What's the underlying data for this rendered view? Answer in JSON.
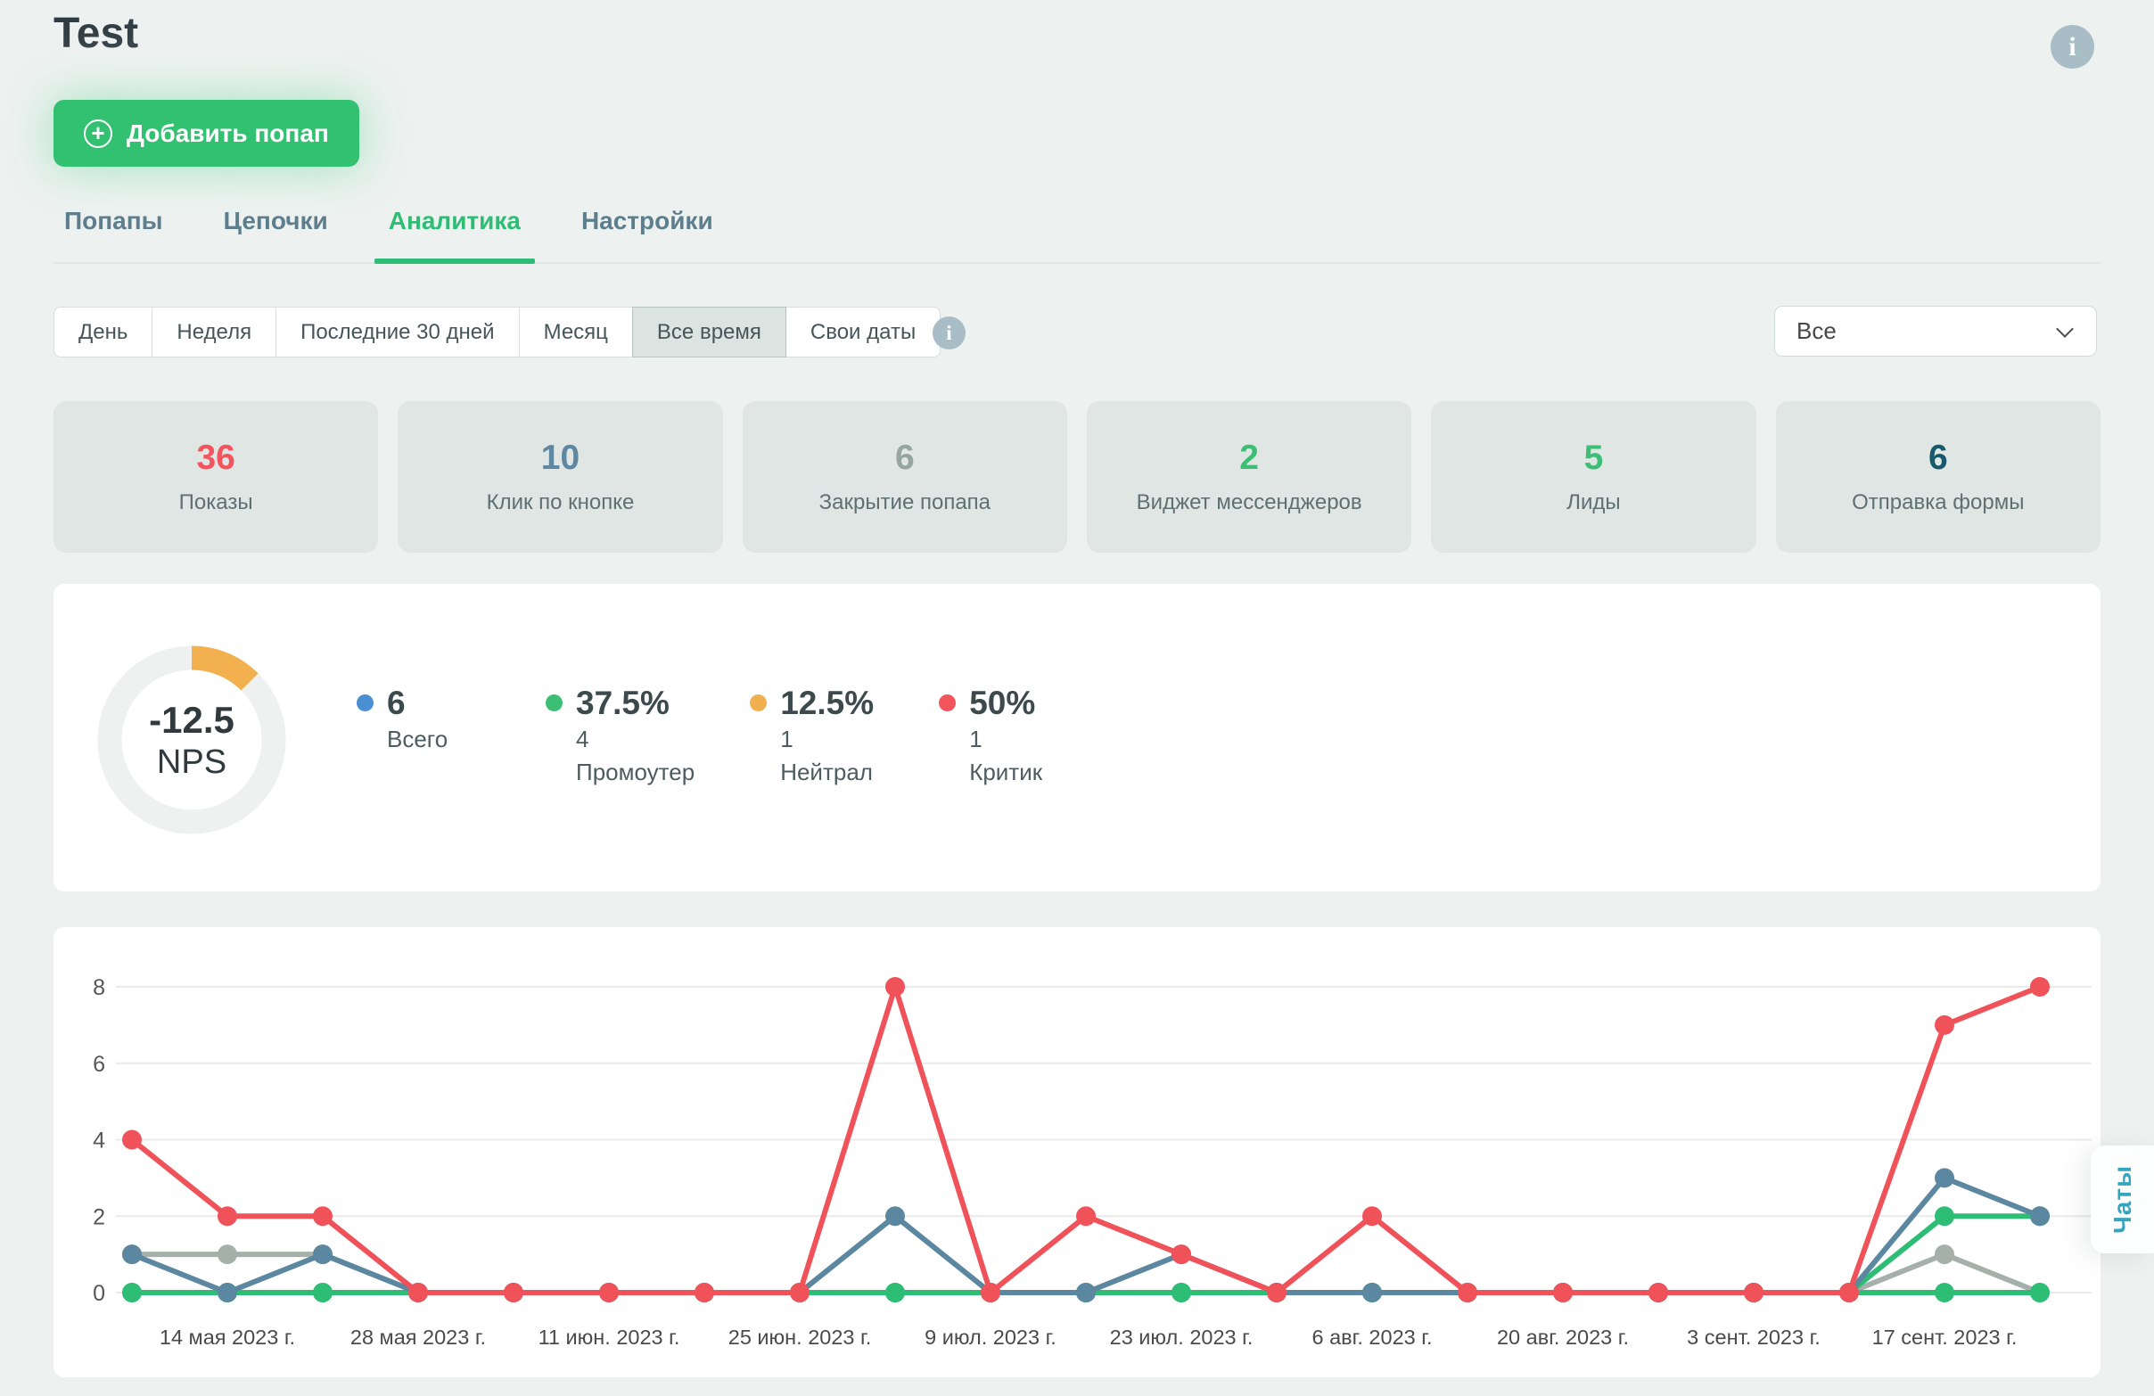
{
  "page": {
    "title": "Test"
  },
  "header": {
    "add_button_label": "Добавить попап",
    "info_icon_glyph": "i"
  },
  "tabs": [
    {
      "label": "Попапы",
      "active": false
    },
    {
      "label": "Цепочки",
      "active": false
    },
    {
      "label": "Аналитика",
      "active": true
    },
    {
      "label": "Настройки",
      "active": false
    }
  ],
  "filters": {
    "options": [
      "День",
      "Неделя",
      "Последние 30 дней",
      "Месяц",
      "Все время",
      "Свои даты"
    ],
    "selected": "Все время",
    "info_icon_glyph": "i"
  },
  "popup_select": {
    "value": "Все"
  },
  "stats": [
    {
      "value": "36",
      "label": "Показы",
      "color": "#f4545e"
    },
    {
      "value": "10",
      "label": "Клик по кнопке",
      "color": "#5e87a1"
    },
    {
      "value": "6",
      "label": "Закрытие попапа",
      "color": "#97a5a0"
    },
    {
      "value": "2",
      "label": "Виджет мессенджеров",
      "color": "#3cbf75"
    },
    {
      "value": "5",
      "label": "Лиды",
      "color": "#3cbf75"
    },
    {
      "value": "6",
      "label": "Отправка формы",
      "color": "#175a6d"
    }
  ],
  "nps": {
    "score": "-12.5",
    "unit": "NPS",
    "gauge_percent": 12.5,
    "arc_color": "#f2b04e",
    "track_color": "#eef1f0",
    "legend": [
      {
        "dot_color": "#4a8fd3",
        "lines": [
          "6",
          "Всего"
        ]
      },
      {
        "dot_color": "#3cbe75",
        "lines": [
          "37.5%",
          "4",
          "Промоутер"
        ]
      },
      {
        "dot_color": "#f0b04f",
        "lines": [
          "12.5%",
          "1",
          "Нейтрал"
        ]
      },
      {
        "dot_color": "#f2555c",
        "lines": [
          "50%",
          "1",
          "Критик"
        ]
      }
    ]
  },
  "chart_data": {
    "type": "line",
    "x_labels": [
      "14 мая 2023 г.",
      "28 мая 2023 г.",
      "11 июн. 2023 г.",
      "25 июн. 2023 г.",
      "9 июл. 2023 г.",
      "23 июл. 2023 г.",
      "6 авг. 2023 г.",
      "20 авг. 2023 г.",
      "3 сент. 2023 г.",
      "17 сент. 2023 г."
    ],
    "label_every": 2,
    "n_points": 21,
    "y_ticks": [
      0,
      2,
      4,
      6,
      8
    ],
    "ylim": [
      0,
      8.6
    ],
    "grid": true,
    "legend_position": "none",
    "series": [
      {
        "name": "gray",
        "color": "#a5b0ab",
        "values": [
          1,
          1,
          1,
          0,
          0,
          0,
          0,
          0,
          0,
          0,
          0,
          0,
          0,
          0,
          0,
          0,
          0,
          0,
          0,
          1,
          0
        ]
      },
      {
        "name": "green-flat",
        "color": "#2ebd74",
        "values": [
          0,
          0,
          0,
          0,
          0,
          0,
          0,
          0,
          0,
          0,
          0,
          0,
          0,
          0,
          0,
          0,
          0,
          0,
          0,
          0,
          0
        ]
      },
      {
        "name": "green",
        "color": "#2ebd74",
        "values": [
          0,
          0,
          0,
          0,
          0,
          0,
          0,
          0,
          0,
          0,
          0,
          0,
          0,
          0,
          0,
          0,
          0,
          0,
          0,
          2,
          2
        ]
      },
      {
        "name": "blue",
        "color": "#5b87a0",
        "values": [
          1,
          0,
          1,
          0,
          0,
          0,
          0,
          0,
          2,
          0,
          0,
          1,
          0,
          0,
          0,
          0,
          0,
          0,
          0,
          3,
          2
        ]
      },
      {
        "name": "red",
        "color": "#f0525a",
        "values": [
          4,
          2,
          2,
          0,
          0,
          0,
          0,
          0,
          8,
          0,
          2,
          1,
          0,
          2,
          0,
          0,
          0,
          0,
          0,
          7,
          8
        ]
      }
    ]
  },
  "chat_tab": {
    "label": "Чаты"
  }
}
